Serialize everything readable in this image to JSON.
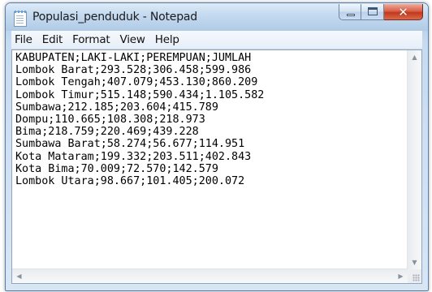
{
  "window": {
    "title": "Populasi_penduduk - Notepad",
    "controls": {
      "minimize": "minimize",
      "maximize": "maximize",
      "close": "✕"
    }
  },
  "menu": [
    "File",
    "Edit",
    "Format",
    "View",
    "Help"
  ],
  "document": {
    "lines": [
      "KABUPATEN;LAKI-LAKI;PEREMPUAN;JUMLAH",
      "Lombok Barat;293.528;306.458;599.986",
      "Lombok Tengah;407.079;453.130;860.209",
      "Lombok Timur;515.148;590.434;1.105.582",
      "Sumbawa;212.185;203.604;415.789",
      "Dompu;110.665;108.308;218.973",
      "Bima;218.759;220.469;439.228",
      "Sumbawa Barat;58.274;56.677;114.951",
      "Kota Mataram;199.332;203.511;402.843",
      "Kota Bima;70.009;72.570;142.579",
      "Lombok Utara;98.667;101.405;200.072"
    ]
  },
  "scrollbar": {
    "up": "▲",
    "down": "▼",
    "left": "◀",
    "right": "▶"
  }
}
